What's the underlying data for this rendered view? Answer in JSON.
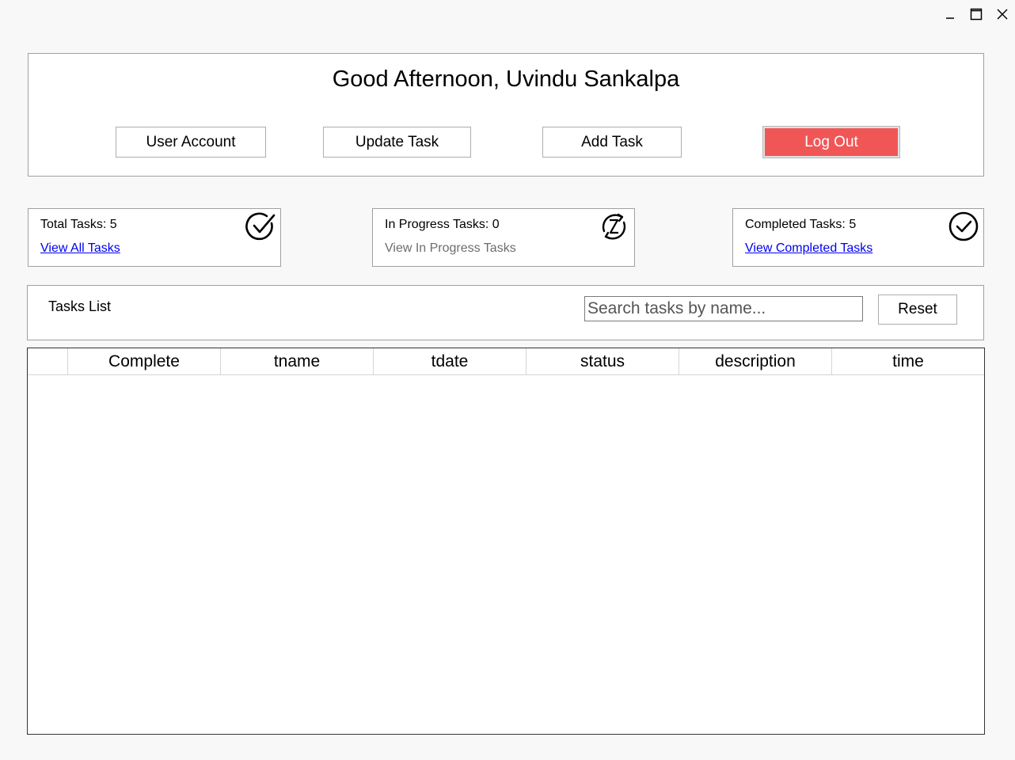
{
  "window": {
    "minimize_icon": "minimize-icon",
    "maximize_icon": "maximize-icon",
    "close_icon": "close-icon"
  },
  "header": {
    "greeting": "Good Afternoon, Uvindu Sankalpa",
    "buttons": {
      "user_account": "User Account",
      "update_task": "Update Task",
      "add_task": "Add Task",
      "log_out": "Log Out"
    },
    "logout_color": "#f15656"
  },
  "stats": {
    "total": {
      "title": "Total Tasks: 5",
      "link": "View All Tasks",
      "icon": "check-circle-icon"
    },
    "in_progress": {
      "title": "In Progress Tasks: 0",
      "link": "View In Progress Tasks",
      "icon": "in-progress-icon"
    },
    "completed": {
      "title": "Completed Tasks: 5",
      "link": "View Completed Tasks",
      "icon": "completed-check-icon"
    }
  },
  "tasks_list": {
    "label": "Tasks List",
    "search_placeholder": "Search tasks by name...",
    "search_value": "",
    "reset_label": "Reset"
  },
  "grid": {
    "columns": [
      "Complete",
      "tname",
      "tdate",
      "status",
      "description",
      "time"
    ],
    "rows": []
  }
}
